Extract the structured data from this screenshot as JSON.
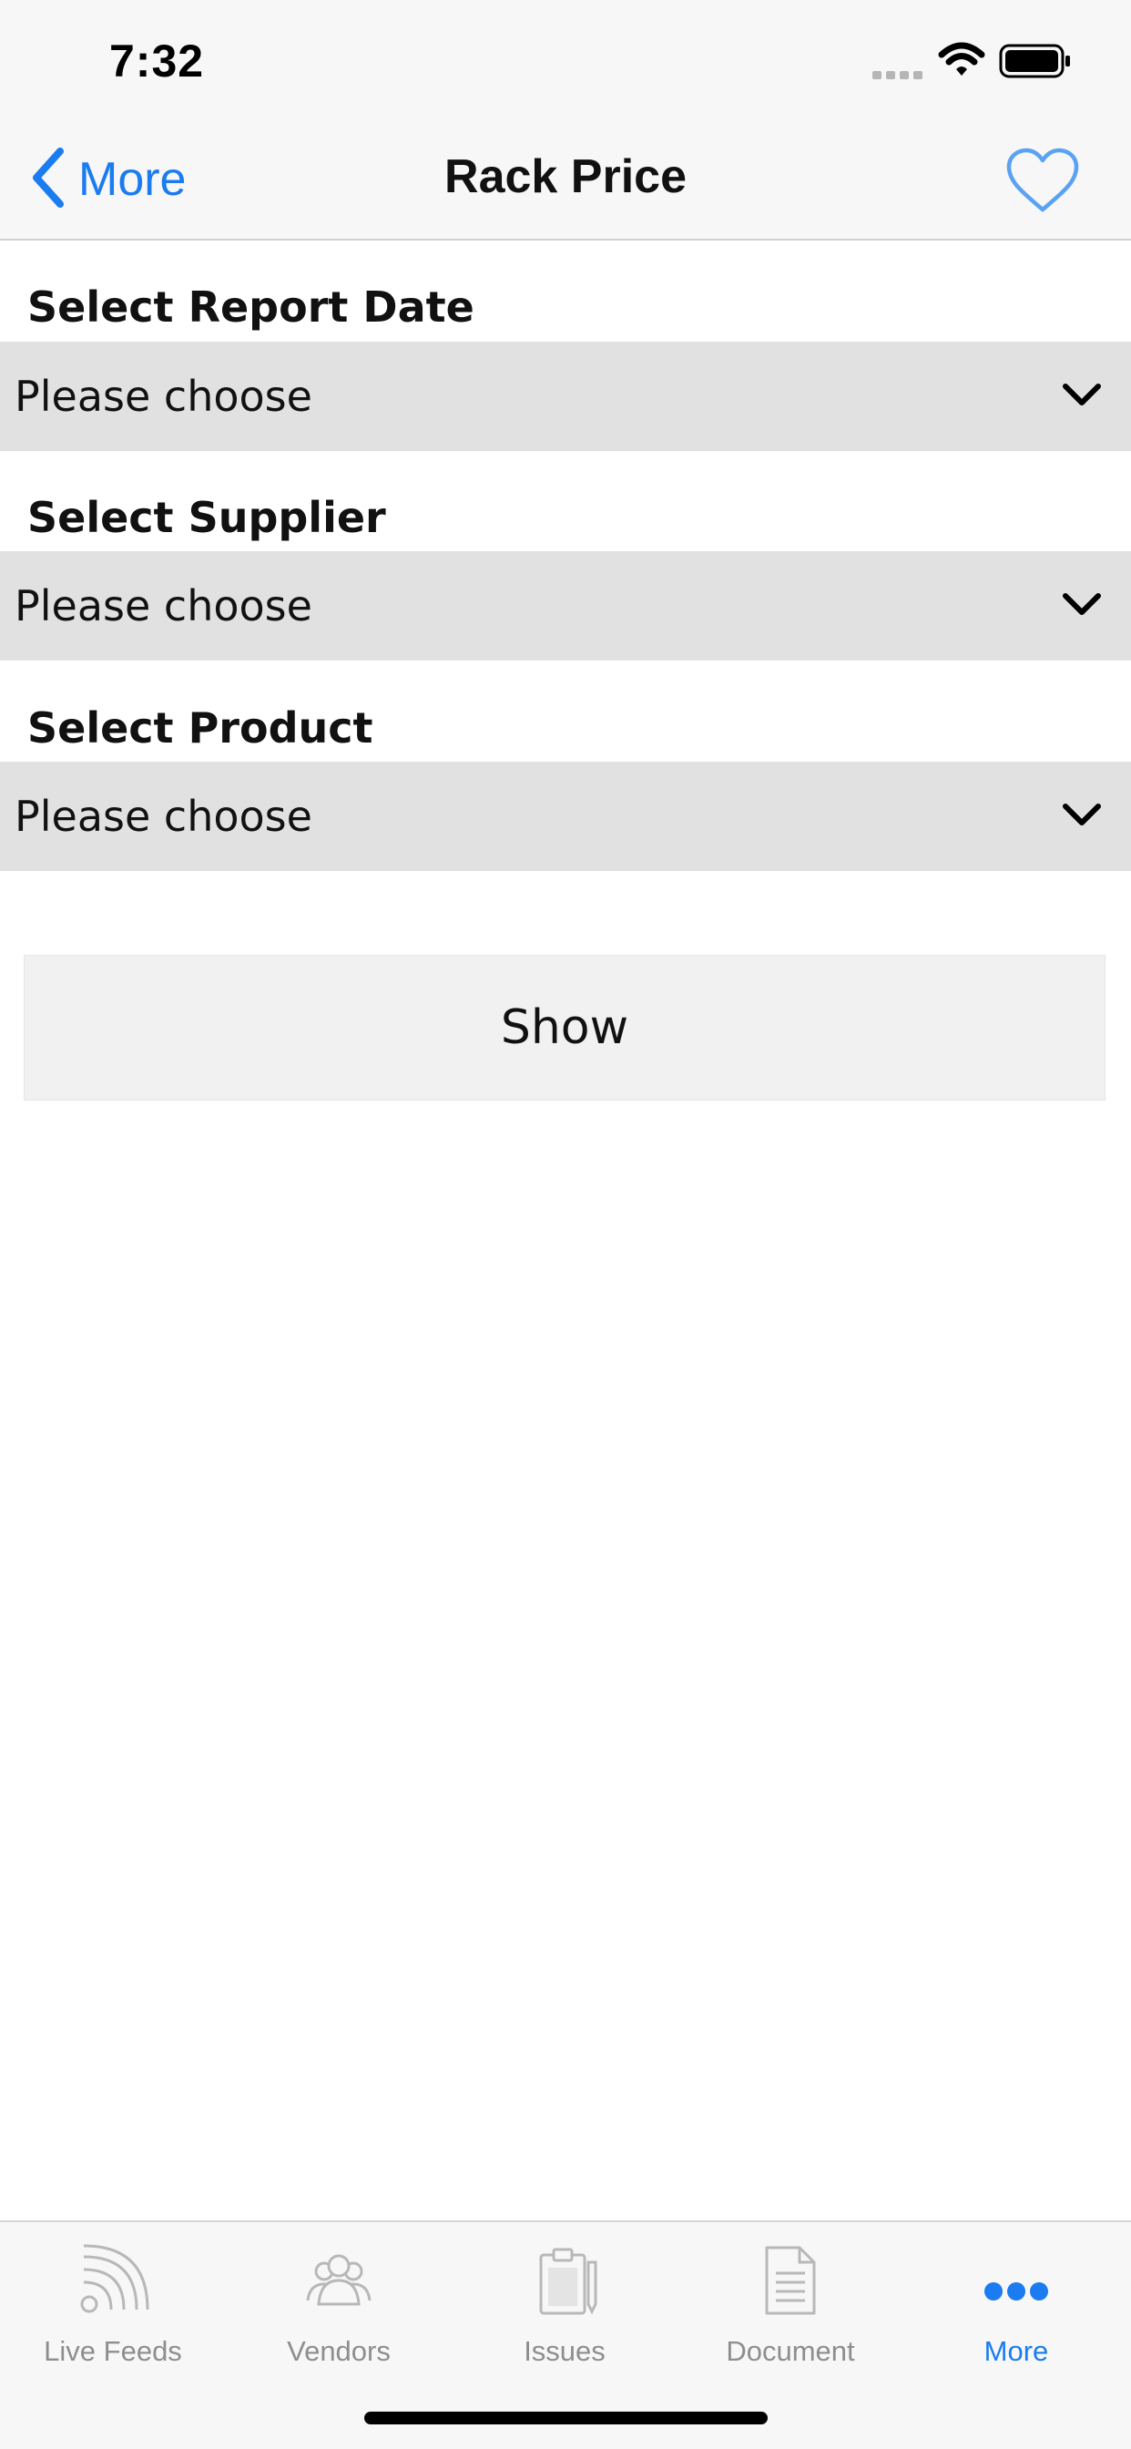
{
  "status_bar": {
    "time": "7:32"
  },
  "nav": {
    "back_label": "More",
    "title": "Rack Price"
  },
  "form": {
    "fields": [
      {
        "label": "Select Report Date",
        "value": "Please choose"
      },
      {
        "label": "Select Supplier",
        "value": "Please choose"
      },
      {
        "label": "Select Product",
        "value": "Please choose"
      }
    ],
    "show_label": "Show"
  },
  "tab_bar": {
    "items": [
      {
        "label": "Live Feeds",
        "icon": "rss-feed-icon",
        "active": false
      },
      {
        "label": "Vendors",
        "icon": "people-icon",
        "active": false
      },
      {
        "label": "Issues",
        "icon": "clipboard-icon",
        "active": false
      },
      {
        "label": "Document",
        "icon": "document-icon",
        "active": false
      },
      {
        "label": "More",
        "icon": "more-dots-icon",
        "active": true
      }
    ]
  },
  "colors": {
    "accent": "#1a7cf0",
    "inactive": "#8e8e8e",
    "select_bg": "#e1e1e1"
  }
}
